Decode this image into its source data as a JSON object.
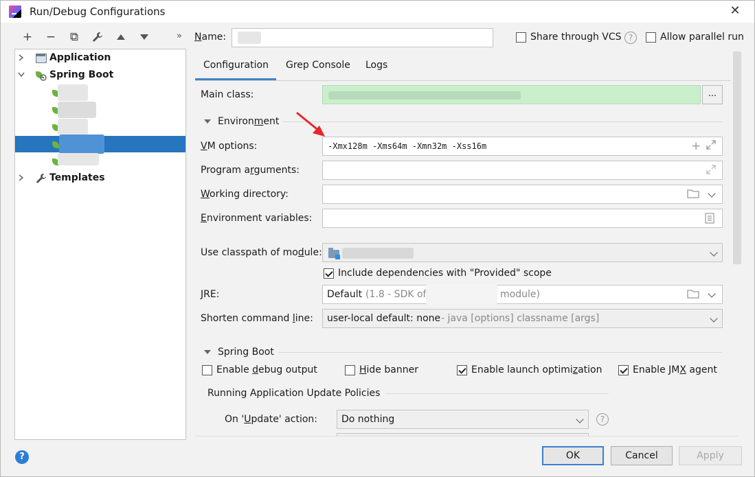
{
  "window": {
    "title": "Run/Debug Configurations"
  },
  "toolbar": {
    "add": "+",
    "remove": "−",
    "copy": "⧉",
    "edit": "🔧",
    "up": "▲",
    "down": "▼",
    "more": "»"
  },
  "tree": {
    "application": "Application",
    "spring_boot": "Spring Boot",
    "templates": "Templates"
  },
  "name_row": {
    "label": "Name:",
    "share_vcs": "Share through VCS",
    "allow_parallel": "Allow parallel run"
  },
  "tabs": [
    "Configuration",
    "Grep Console",
    "Logs"
  ],
  "form": {
    "main_class_label": "Main class:",
    "ellipsis": "...",
    "environment_title": "Environment",
    "vm_options_label": "VM options:",
    "vm_options_value": "-Xmx128m -Xms64m -Xmn32m -Xss16m",
    "program_args_label": "Program arguments:",
    "working_dir_label": "Working directory:",
    "env_vars_label": "Environment variables:",
    "classpath_label": "Use classpath of module:",
    "include_deps": "Include dependencies with \"Provided\" scope",
    "jre_label": "JRE:",
    "jre_value_prefix": "Default",
    "jre_value_mid": "(1.8 - SDK of",
    "jre_value_suffix": "module)",
    "shorten_label": "Shorten command line:",
    "shorten_value": "user-local default: none",
    "shorten_hint": "- java [options] classname [args]",
    "spring_boot_title": "Spring Boot",
    "enable_debug": "Enable debug output",
    "hide_banner": "Hide banner",
    "enable_launch": "Enable launch optimization",
    "enable_jmx": "Enable JMX agent",
    "update_policies_title": "Running Application Update Policies",
    "on_update_label": "On 'Update' action:",
    "on_update_value": "Do nothing"
  },
  "buttons": {
    "ok": "OK",
    "cancel": "Cancel",
    "apply": "Apply",
    "help": "?"
  },
  "colors": {
    "selection": "#2675bf",
    "main_class_bg": "#c9efcb",
    "accent": "#4083c9",
    "arrow": "#e8262c"
  }
}
